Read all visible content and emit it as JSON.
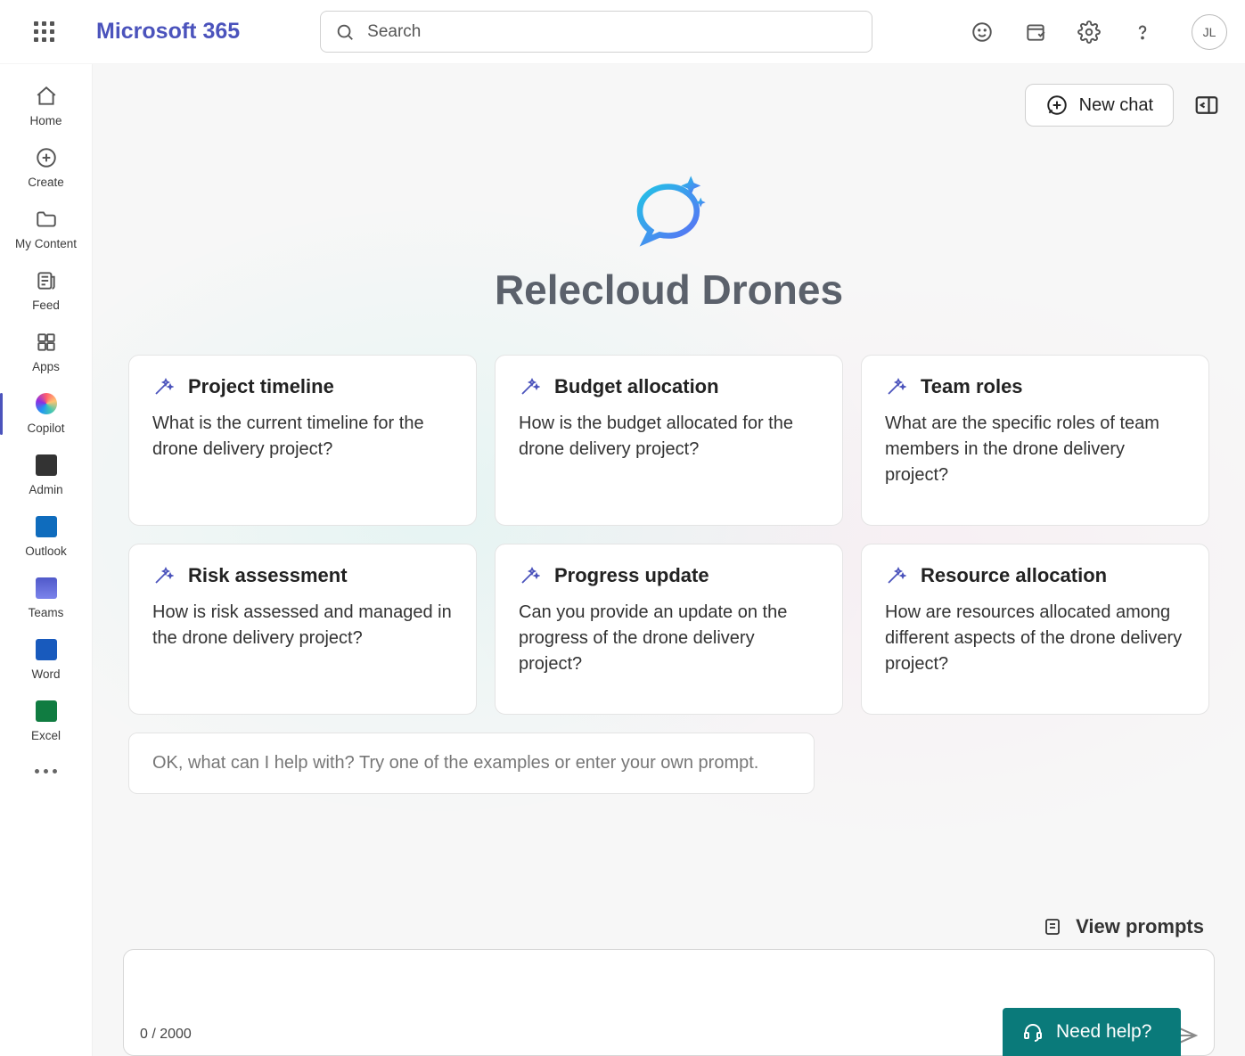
{
  "header": {
    "brand": "Microsoft 365",
    "search_placeholder": "Search",
    "avatar_initials": "JL"
  },
  "sidebar": {
    "items": [
      {
        "label": "Home"
      },
      {
        "label": "Create"
      },
      {
        "label": "My Content"
      },
      {
        "label": "Feed"
      },
      {
        "label": "Apps"
      },
      {
        "label": "Copilot"
      },
      {
        "label": "Admin"
      },
      {
        "label": "Outlook"
      },
      {
        "label": "Teams"
      },
      {
        "label": "Word"
      },
      {
        "label": "Excel"
      }
    ]
  },
  "topbar": {
    "new_chat": "New chat"
  },
  "hero": {
    "title": "Relecloud Drones"
  },
  "cards": [
    {
      "title": "Project timeline",
      "body": "What is the current timeline for the drone delivery project?"
    },
    {
      "title": "Budget allocation",
      "body": "How is the budget allocated for the drone delivery project?"
    },
    {
      "title": "Team roles",
      "body": "What are the specific roles of team members in the drone delivery project?"
    },
    {
      "title": "Risk assessment",
      "body": "How is risk assessed and managed in the drone delivery project?"
    },
    {
      "title": "Progress update",
      "body": "Can you provide an update on the progress of the drone delivery project?"
    },
    {
      "title": "Resource allocation",
      "body": "How are resources allocated among different aspects of the drone delivery project?"
    }
  ],
  "example_bar": "OK, what can I help with? Try one of the examples or enter your own prompt.",
  "footer": {
    "view_prompts": "View prompts",
    "counter": "0 / 2000",
    "need_help": "Need help?"
  }
}
